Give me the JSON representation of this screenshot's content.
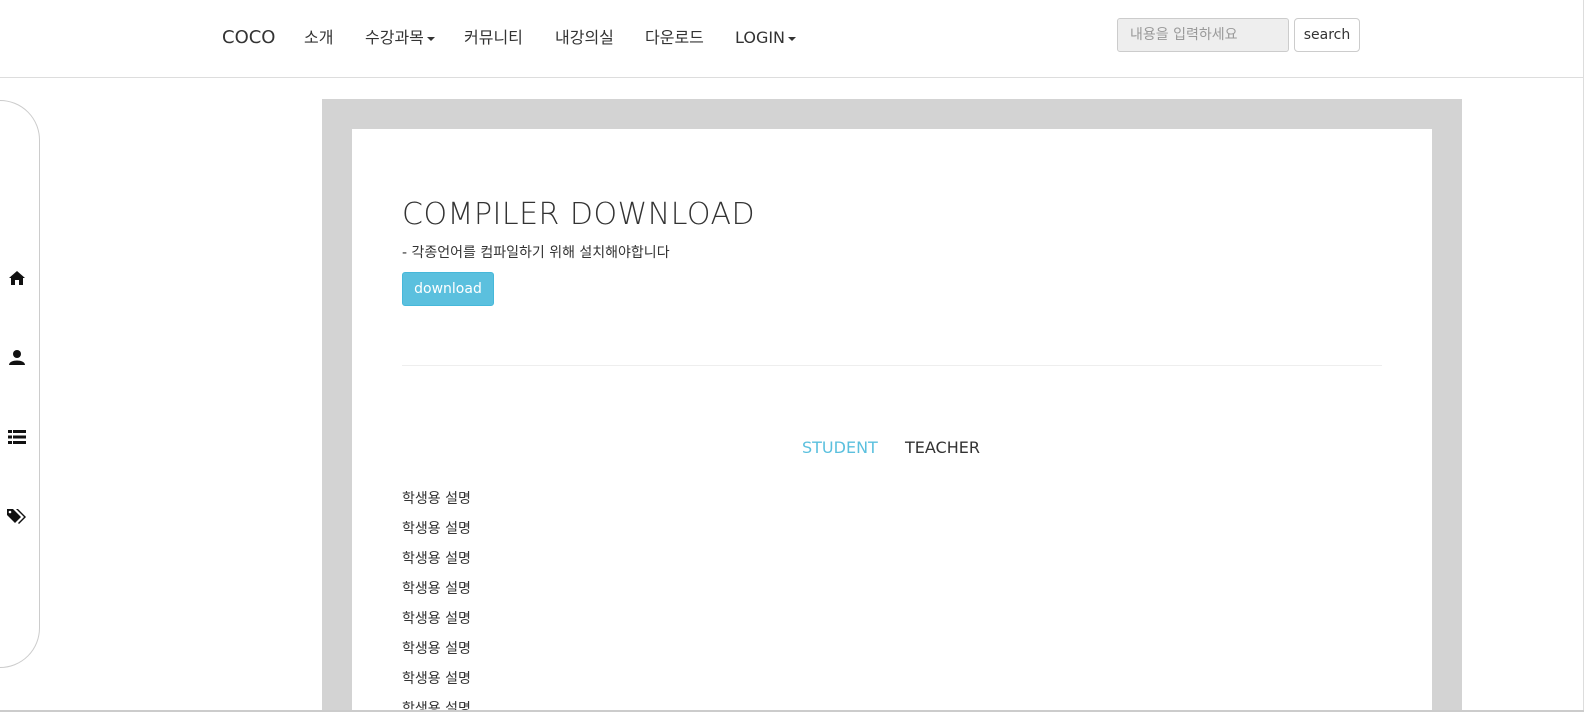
{
  "navbar": {
    "brand": "COCO",
    "items": [
      {
        "label": "소개",
        "dropdown": false
      },
      {
        "label": "수강과목",
        "dropdown": true
      },
      {
        "label": "커뮤니티",
        "dropdown": false
      },
      {
        "label": "내강의실",
        "dropdown": false
      },
      {
        "label": "다운로드",
        "dropdown": false
      },
      {
        "label": "LOGIN",
        "dropdown": true
      }
    ],
    "search": {
      "placeholder": "내용을 입력하세요",
      "value": "",
      "button_label": "search"
    }
  },
  "sidebar": {
    "icons": [
      "home-icon",
      "user-icon",
      "list-icon",
      "tags-icon"
    ]
  },
  "main": {
    "title": "COMPILER DOWNLOAD",
    "subtitle": "- 각종언어를 컴파일하기 위해 설치해야합니다",
    "download_label": "download",
    "tabs": [
      {
        "label": "STUDENT",
        "active": true
      },
      {
        "label": "TEACHER",
        "active": false
      }
    ],
    "descriptions": [
      "학생용 설명",
      "학생용 설명",
      "학생용 설명",
      "학생용 설명",
      "학생용 설명",
      "학생용 설명",
      "학생용 설명",
      "학생용 설명"
    ]
  },
  "colors": {
    "accent": "#5bc0de",
    "panel_bg": "#d3d3d3",
    "text": "#333333"
  }
}
